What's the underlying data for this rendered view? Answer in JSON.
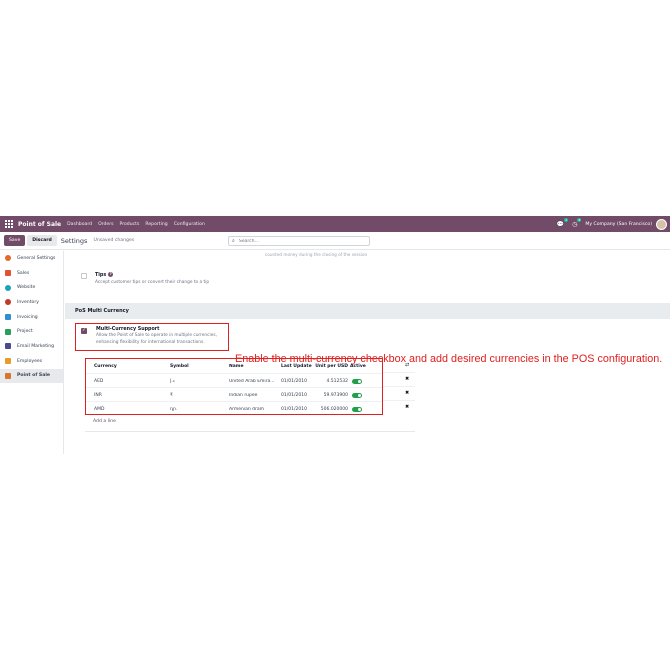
{
  "nav": {
    "app_name": "Point of Sale",
    "menu": [
      "Dashboard",
      "Orders",
      "Products",
      "Reporting",
      "Configuration"
    ],
    "chat_badge": "1",
    "activity_badge": "8",
    "company": "My Company (San Francisco)"
  },
  "control": {
    "save_label": "Save",
    "discard_label": "Discard",
    "breadcrumb": "Settings",
    "status": "Unsaved changes",
    "search_placeholder": "Search..."
  },
  "sidebar": {
    "items": [
      {
        "label": "General Settings",
        "color": "#e46a2a"
      },
      {
        "label": "Sales",
        "color": "#e0532e"
      },
      {
        "label": "Website",
        "color": "#1da0b9"
      },
      {
        "label": "Inventory",
        "color": "#c0392b"
      },
      {
        "label": "Invoicing",
        "color": "#2f8fd0"
      },
      {
        "label": "Project",
        "color": "#27a05a"
      },
      {
        "label": "Email Marketing",
        "color": "#4a4a8c"
      },
      {
        "label": "Employees",
        "color": "#e89c2a"
      },
      {
        "label": "Point of Sale",
        "color": "#d9752b"
      }
    ]
  },
  "main": {
    "faded_text": "counted money during the closing of the session",
    "tips": {
      "title": "Tips",
      "desc": "Accept customer tips or convert their change to a tip"
    },
    "section_title": "PoS Multi Currency",
    "multi_currency": {
      "title": "Multi-Currency Support",
      "desc_line1": "Allow the Point of Sale to operate in multiple currencies,",
      "desc_line2": "enhancing flexibility for international transactions."
    },
    "annotation": "Enable the multi-currency checkbox and add desired currencies in the POS configuration.",
    "table": {
      "headers": [
        "Currency",
        "Symbol",
        "Name",
        "Last Update",
        "Unit per USD",
        "Active"
      ],
      "rows": [
        {
          "currency": "AED",
          "symbol": "د.إ",
          "name": "United Arab Emira...",
          "date": "01/01/2010",
          "rate": "4.512532"
        },
        {
          "currency": "INR",
          "symbol": "₹",
          "name": "Indian rupee",
          "date": "01/01/2010",
          "rate": "59.973900"
        },
        {
          "currency": "AMD",
          "symbol": "դր.",
          "name": "Armenian dram",
          "date": "01/01/2010",
          "rate": "506.020000"
        }
      ]
    },
    "add_line": "Add a line"
  },
  "colors": {
    "brand": "#714B67",
    "annotation": "#e02020",
    "toggle_on": "#21a04c"
  }
}
